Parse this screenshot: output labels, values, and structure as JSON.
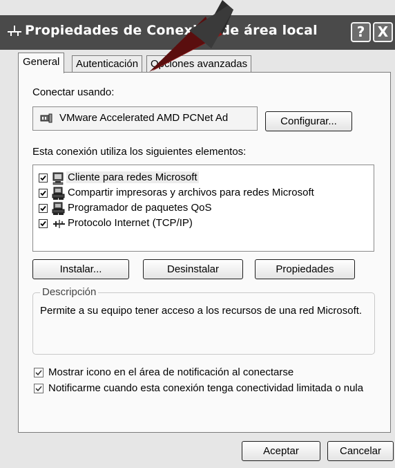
{
  "window": {
    "title": "Propiedades de Conexión de área local",
    "help_button": "?",
    "close_button": "X"
  },
  "tabs": [
    "General",
    "Autenticación",
    "Opciones avanzadas"
  ],
  "general": {
    "connect_using_label": "Conectar usando:",
    "adapter_name": "VMware Accelerated AMD PCNet Ad",
    "configure_button": "Configurar...",
    "components_label": "Esta conexión utiliza los siguientes elementos:",
    "components": [
      {
        "label": "Cliente para redes Microsoft",
        "checked": true,
        "icon": "network-client-icon"
      },
      {
        "label": "Compartir impresoras y archivos para redes Microsoft",
        "checked": true,
        "icon": "file-printer-sharing-icon"
      },
      {
        "label": "Programador de paquetes QoS",
        "checked": true,
        "icon": "qos-scheduler-icon"
      },
      {
        "label": "Protocolo Internet (TCP/IP)",
        "checked": true,
        "icon": "protocol-icon"
      }
    ],
    "install_button": "Instalar...",
    "uninstall_button": "Desinstalar",
    "properties_button": "Propiedades",
    "description_group_label": "Descripción",
    "description_text": "Permite a su equipo tener acceso a los recursos de una red Microsoft.",
    "show_icon_option": {
      "label": "Mostrar icono en el área de notificación al conectarse",
      "checked": true
    },
    "notify_option": {
      "label": "Notificarme cuando esta conexión tenga conectividad limitada o nula",
      "checked": true
    }
  },
  "footer": {
    "ok_button": "Aceptar",
    "cancel_button": "Cancelar"
  },
  "colors": {
    "titlebar": "#4a4a4a",
    "annotation_arrow": "#8b1a1a"
  }
}
